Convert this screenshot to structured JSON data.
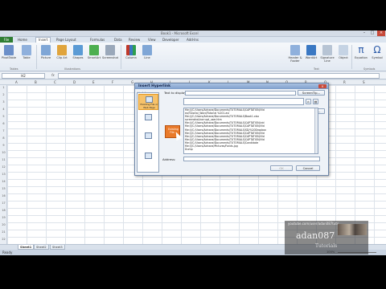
{
  "window": {
    "title": "Book1 - Microsoft Excel"
  },
  "ribbon": {
    "tabs": [
      "File",
      "Home",
      "Insert",
      "Page Layout",
      "Formulas",
      "Data",
      "Review",
      "View",
      "Developer",
      "Add-Ins"
    ],
    "buttons_left": [
      "PivotTable",
      "Table",
      "Picture",
      "Clip Art",
      "Shapes",
      "SmartArt",
      "Screenshot",
      "Column",
      "Line"
    ],
    "buttons_right": [
      "Header & Footer",
      "WordArt",
      "Signature Line",
      "Object",
      "Equation",
      "Symbol"
    ],
    "groups": [
      "Tables",
      "Illustrations",
      "Text",
      "Symbols"
    ]
  },
  "formula_bar": {
    "name_box": "H2",
    "fx": "fx"
  },
  "grid": {
    "columns": [
      "A",
      "B",
      "C",
      "D",
      "E",
      "F",
      "G",
      "H",
      "I",
      "J",
      "K",
      "L",
      "M",
      "N",
      "O",
      "P",
      "Q",
      "R",
      "S"
    ],
    "rows": [
      "1",
      "2",
      "3",
      "4",
      "5",
      "6",
      "7",
      "8",
      "9",
      "10",
      "11",
      "12",
      "13",
      "14",
      "15",
      "16",
      "17",
      "18",
      "19",
      "20",
      "21",
      "22"
    ]
  },
  "sheets": [
    "Sheet1",
    "Sheet2",
    "Sheet3"
  ],
  "status": {
    "ready": "Ready",
    "zoom": "100%"
  },
  "dialog": {
    "title": "Insert Hyperlink",
    "link_to_label": "Link to:",
    "text_to_display_label": "Text to display:",
    "screentip_button": "ScreenTip...",
    "bookmark_button": "Bookmark...",
    "address_label": "Address:",
    "ok_button": "OK",
    "cancel_button": "Cancel",
    "link_options": [
      "Existing File or Web Page",
      "Place in This Document",
      "Create New Document",
      "E-mail Address"
    ],
    "drag_label": "Existing File...",
    "files": [
      "file:///C:/Users/Adnane/Documents/TUTORIALS/CAPTATION/Vid",
      "eo/Tutorial_Word/Tutorial %201.avi",
      "file:///C:/Users/Adnane/Documents/TUTORIALS/Book1.xlsx",
      "screenshot/corrupt_user.htm",
      "file:///C:/Users/Adnane/Documents/TUTORIALS/CAPTATION/vid",
      "file:///C:/Users/Adnane/Documents/TUTORIALS/CAPTATION/Vid",
      "file:///C:/Users/Adnane/Documents/TUTORIALS/SD/%20Dropbox",
      "file:///C:/Users/Adnane/Documents/TUTORIALS/CAPTATION/Vid",
      "file:///C:/Users/Adnane/Documents/TUTORIALS/CAPTATION/Vid",
      "file:///C:/Users/Adnane/Documents/TUTORIALS/CAPTATION/Vid",
      "file:///C:/Users/Adnane/Documents/TUTORIALS/Candidate",
      "file:///C:/Users/Adnane/Pictures/Fonds.jpg",
      "Dump"
    ]
  },
  "watermark": {
    "url": "youtube.com/user/adan087tuts",
    "name": "adan087",
    "sub": "Tutorials"
  }
}
